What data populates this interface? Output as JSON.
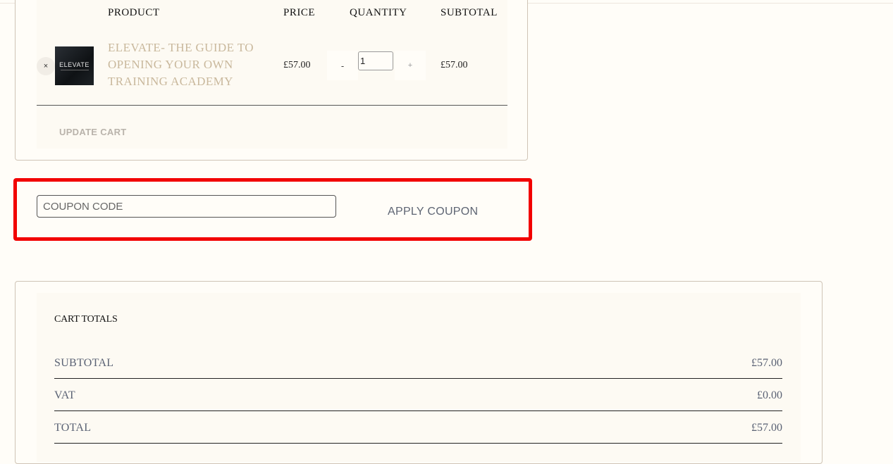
{
  "cart": {
    "headers": {
      "product": "PRODUCT",
      "price": "PRICE",
      "quantity": "QUANTITY",
      "subtotal": "SUBTOTAL"
    },
    "item": {
      "remove": "×",
      "thumb_text": "ELEVATE",
      "name": "ELEVATE- THE GUIDE TO OPENING YOUR OWN TRAINING ACADEMY",
      "price": "£57.00",
      "qty_minus": "-",
      "qty_value": "1",
      "qty_plus": "+",
      "subtotal": "£57.00"
    },
    "update_label": "UPDATE CART"
  },
  "coupon": {
    "placeholder": "COUPON CODE",
    "apply_label": "APPLY COUPON",
    "highlight_color": "#f20000"
  },
  "totals": {
    "title": "CART TOTALS",
    "rows": [
      {
        "label": "SUBTOTAL",
        "value": "£57.00"
      },
      {
        "label": "VAT",
        "value": "£0.00"
      },
      {
        "label": "TOTAL",
        "value": "£57.00"
      }
    ]
  }
}
